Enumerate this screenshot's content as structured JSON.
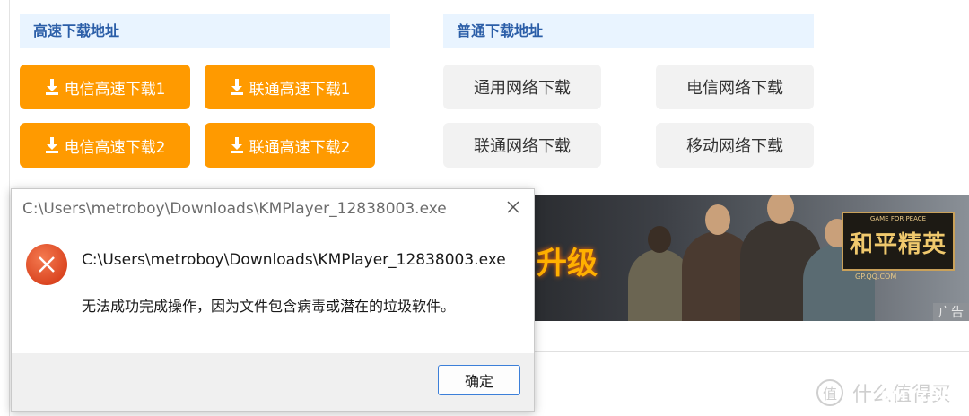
{
  "sections": {
    "fast": {
      "title": "高速下载地址"
    },
    "normal": {
      "title": "普通下载地址"
    }
  },
  "fast_buttons": [
    "电信高速下载1",
    "联通高速下载1",
    "电信高速下载2",
    "联通高速下载2"
  ],
  "normal_buttons": [
    "通用网络下载",
    "电信网络下载",
    "联通网络下载",
    "移动网络下载"
  ],
  "banner": {
    "text": "升级",
    "logo_small": "GAME FOR PEACE",
    "logo_big": "和平精英",
    "logo_url": "GP.QQ.COM",
    "ad_label": "广告"
  },
  "dialog": {
    "title": "C:\\Users\\metroboy\\Downloads\\KMPlayer_12838003.exe",
    "path": "C:\\Users\\metroboy\\Downloads\\KMPlayer_12838003.exe",
    "message": "无法成功完成操作，因为文件包含病毒或潜在的垃圾软件。",
    "ok_label": "确定",
    "close_icon": "close-icon",
    "error_icon": "error-icon"
  },
  "watermark": {
    "icon_char": "值",
    "text": "什么值得买",
    "site": "SMYZ.NET"
  },
  "colors": {
    "orange": "#ff9a00",
    "section_bg": "#e9f4ff",
    "section_text": "#2b5ea8",
    "error_red": "#e8552c"
  }
}
